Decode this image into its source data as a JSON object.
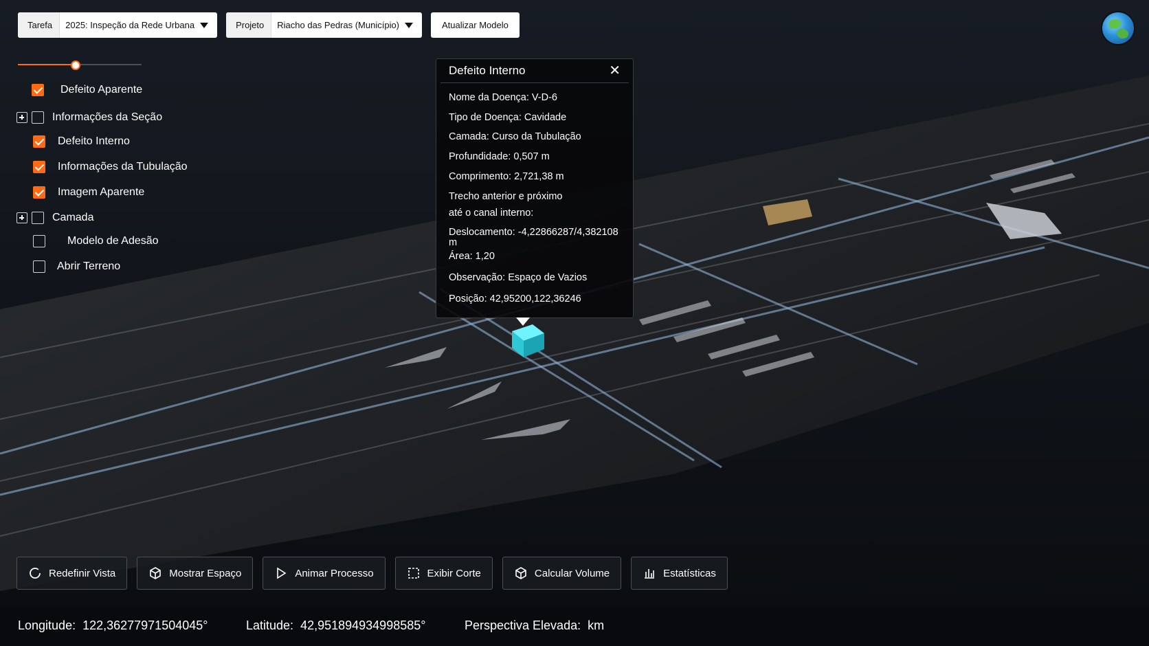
{
  "toolbar": {
    "task_label": "Tarefa",
    "task_value": "2025: Inspeção da Rede Urbana",
    "project_label": "Projeto",
    "project_value": "Riacho das Pedras (Município)",
    "update_button": "Atualizar Modelo"
  },
  "opacity_slider": {
    "value_fraction": 0.46
  },
  "layers": [
    {
      "label": "Defeito Aparente",
      "checked": true,
      "expandable": false
    },
    {
      "label": "Informações da Seção",
      "checked": false,
      "expandable": true
    },
    {
      "label": "Defeito Interno",
      "checked": true,
      "expandable": false
    },
    {
      "label": "Informações da Tubulação",
      "checked": true,
      "expandable": false
    },
    {
      "label": "Imagem Aparente",
      "checked": true,
      "expandable": false
    },
    {
      "label": "Camada",
      "checked": false,
      "expandable": true
    },
    {
      "label": "Modelo de Adesão",
      "checked": false,
      "expandable": false
    },
    {
      "label": "Abrir Terreno",
      "checked": false,
      "expandable": false
    }
  ],
  "popup": {
    "title": "Defeito Interno",
    "close_icon": "close-icon",
    "lines": [
      "Nome da Doença: V-D-6",
      "Tipo de Doença: Cavidade",
      "Camada: Curso da Tubulação",
      "Profundidade: 0,507 m",
      "Comprimento: 2,721,38 m",
      "Trecho anterior e próximo",
      "até o canal interno:",
      "Deslocamento: -4,22866287/4,382108",
      "m",
      "Área: 1,20",
      "Observação: Espaço de Vazios",
      "Posição: 42,95200,122,36246"
    ]
  },
  "tools": [
    {
      "label": "Redefinir Vista",
      "icon": "refresh-icon"
    },
    {
      "label": "Mostrar Espaço",
      "icon": "cube-icon"
    },
    {
      "label": "Animar Processo",
      "icon": "play-icon"
    },
    {
      "label": "Exibir Corte",
      "icon": "dashed-square-icon"
    },
    {
      "label": "Calcular Volume",
      "icon": "cube-icon"
    },
    {
      "label": "Estatísticas",
      "icon": "bar-chart-icon"
    }
  ],
  "status": {
    "longitude_label": "Longitude:",
    "longitude_value": "122,36277971504045°",
    "latitude_label": "Latitude:",
    "latitude_value": "42,951894934998585°",
    "elevation_label": "Perspectiva Elevada:",
    "elevation_value": "km"
  },
  "colors": {
    "accent": "#ff6a13",
    "highlight": "#37d6e6"
  }
}
